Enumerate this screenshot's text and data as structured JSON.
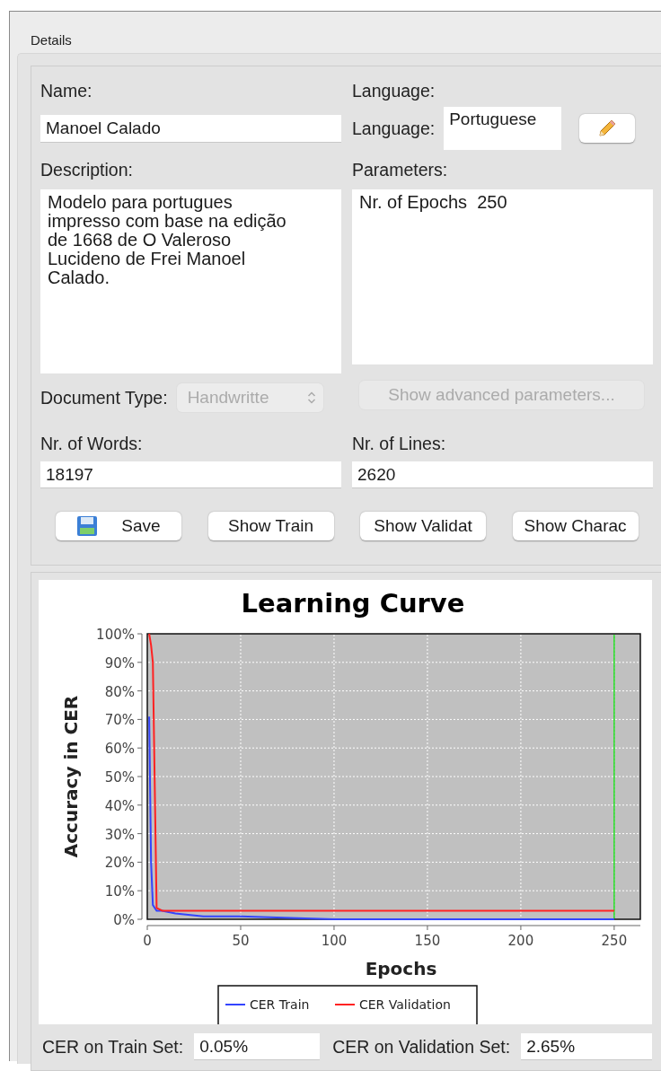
{
  "frame": {
    "title": "Details"
  },
  "form": {
    "name": {
      "label": "Name:",
      "value": "Manoel Calado"
    },
    "language": {
      "heading": "Language:",
      "label": "Language:",
      "value": "Portuguese"
    },
    "description": {
      "label": "Description:",
      "value": "Modelo para portugues impresso com base na edição de 1668 de O Valeroso Lucideno de Frei Manoel Calado."
    },
    "parameters": {
      "label": "Parameters:",
      "value": "Nr. of Epochs  250"
    },
    "document_type": {
      "label": "Document Type:",
      "value": "Handwritte",
      "disabled": true
    },
    "advanced_button": {
      "label": "Show advanced parameters...",
      "disabled": true
    },
    "words": {
      "label": "Nr. of Words:",
      "value": "18197"
    },
    "lines": {
      "label": "Nr. of Lines:",
      "value": "2620"
    },
    "buttons": [
      {
        "label": "Save",
        "kind": "save"
      },
      {
        "label": "Show Train",
        "kind": "plain"
      },
      {
        "label": "Show Validat",
        "kind": "plain"
      },
      {
        "label": "Show Charac",
        "kind": "plain"
      }
    ]
  },
  "chart": {
    "chart_data": {
      "type": "line",
      "title": "Learning Curve",
      "xlabel": "Epochs",
      "ylabel": "Accuracy in CER",
      "x": [
        1,
        2,
        3,
        5,
        8,
        15,
        30,
        50,
        100,
        150,
        200,
        250
      ],
      "series": [
        {
          "name": "CER Train",
          "color": "#3344ff",
          "values": [
            71,
            20,
            5,
            3,
            3,
            2,
            1,
            1,
            0,
            0,
            0,
            0
          ]
        },
        {
          "name": "CER Validation",
          "color": "#ff2222",
          "values": [
            100,
            96,
            90,
            4,
            3,
            3,
            3,
            3,
            3,
            3,
            3,
            3
          ]
        }
      ],
      "xlim": [
        0,
        264
      ],
      "ylim": [
        0,
        100
      ],
      "xticks": [
        0,
        50,
        100,
        150,
        200,
        250
      ],
      "yticks": [
        {
          "value": 0,
          "label": "0%"
        },
        {
          "value": 10,
          "label": "10%"
        },
        {
          "value": 20,
          "label": "20%"
        },
        {
          "value": 30,
          "label": "30%"
        },
        {
          "value": 40,
          "label": "40%"
        },
        {
          "value": 50,
          "label": "50%"
        },
        {
          "value": 60,
          "label": "60%"
        },
        {
          "value": 70,
          "label": "70%"
        },
        {
          "value": 80,
          "label": "80%"
        },
        {
          "value": 90,
          "label": "90%"
        },
        {
          "value": 100,
          "label": "100%"
        }
      ],
      "grid": true,
      "legend": true,
      "ref_lines": [
        {
          "axis": "x",
          "value": 250,
          "color": "#22dd22"
        }
      ]
    }
  },
  "results": [
    {
      "label": "CER on Train Set:",
      "value": "0.05%"
    },
    {
      "label": "CER on Validation Set:",
      "value": "2.65%"
    }
  ]
}
